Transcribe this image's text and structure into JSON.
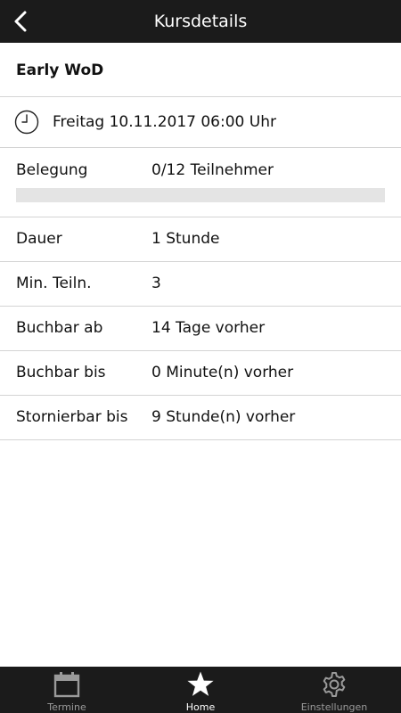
{
  "header": {
    "title": "Kursdetails"
  },
  "course": {
    "title": "Early WoD",
    "datetime": "Freitag 10.11.2017 06:00 Uhr"
  },
  "occupancy": {
    "label": "Belegung",
    "value": "0/12 Teilnehmer",
    "fill_fraction": 0
  },
  "details": [
    {
      "label": "Dauer",
      "value": "1 Stunde"
    },
    {
      "label": "Min. Teiln.",
      "value": "3"
    },
    {
      "label": "Buchbar ab",
      "value": "14 Tage vorher"
    },
    {
      "label": "Buchbar bis",
      "value": "0 Minute(n) vorher"
    },
    {
      "label": "Stornierbar bis",
      "value": "9 Stunde(n) vorher"
    }
  ],
  "bottom_nav": {
    "items": [
      {
        "label": "Termine",
        "icon": "calendar-icon",
        "active": false
      },
      {
        "label": "Home",
        "icon": "star-icon",
        "active": true
      },
      {
        "label": "Einstellungen",
        "icon": "gear-icon",
        "active": false
      }
    ]
  },
  "colors": {
    "bar_background": "#1b1b1b",
    "divider": "#d4d4d4",
    "progress_track": "#e4e4e4"
  }
}
